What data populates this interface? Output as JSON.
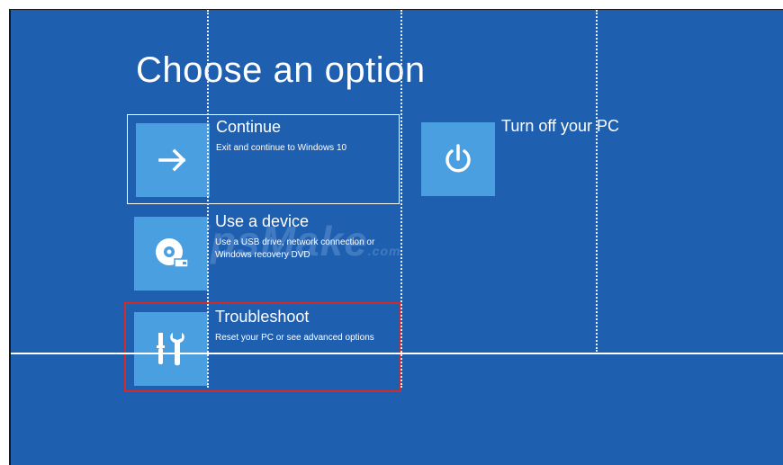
{
  "title": "Choose an option",
  "options": [
    {
      "label": "Continue",
      "desc": "Exit and continue to Windows 10",
      "icon": "arrow-right-icon"
    },
    {
      "label": "Use a device",
      "desc": "Use a USB drive, network connection or Windows recovery DVD",
      "icon": "disc-drive-icon"
    },
    {
      "label": "Troubleshoot",
      "desc": "Reset your PC or see advanced options",
      "icon": "tools-icon"
    },
    {
      "label": "Turn off your PC",
      "desc": "",
      "icon": "power-icon"
    }
  ],
  "watermark": "TipsMake",
  "watermark_suffix": ".com",
  "colors": {
    "background": "#1f5fb0",
    "tile": "#4a9fe0",
    "highlight": "#d32a2a"
  }
}
